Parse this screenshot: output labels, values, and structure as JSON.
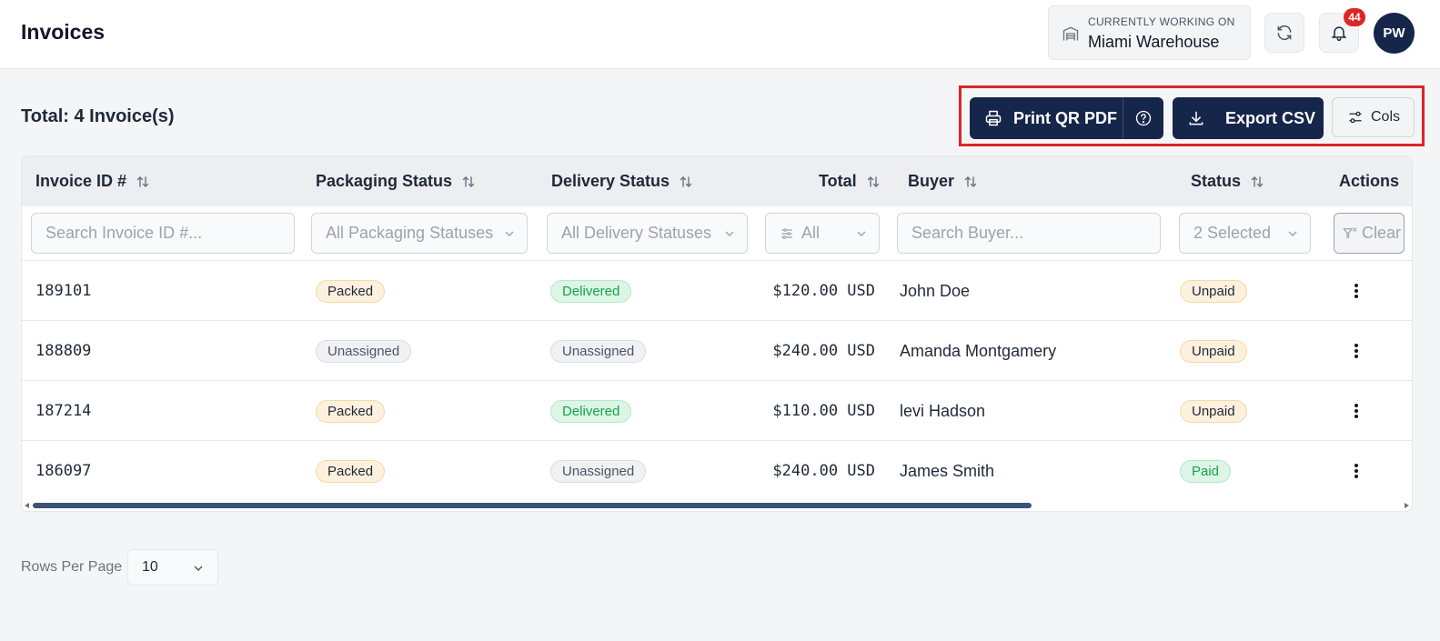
{
  "header": {
    "title": "Invoices",
    "workspace_label": "CURRENTLY WORKING ON",
    "workspace_name": "Miami Warehouse",
    "notification_count": "44",
    "avatar_initials": "PW"
  },
  "toolbar": {
    "total_text": "Total: 4 Invoice(s)",
    "print_label": "Print QR PDF",
    "export_label": "Export CSV",
    "cols_label": "Cols"
  },
  "table": {
    "columns": [
      "Invoice ID #",
      "Packaging Status",
      "Delivery Status",
      "Total",
      "Buyer",
      "Status",
      "Actions"
    ],
    "filters": {
      "invoice_placeholder": "Search Invoice ID #...",
      "packaging": "All Packaging Statuses",
      "delivery": "All Delivery Statuses",
      "total": "All",
      "buyer_placeholder": "Search Buyer...",
      "status": "2 Selected",
      "clear": "Clear"
    },
    "rows": [
      {
        "id": "189101",
        "packaging": "Packed",
        "delivery": "Delivered",
        "total": "$120.00 USD",
        "buyer": "John Doe",
        "status": "Unpaid"
      },
      {
        "id": "188809",
        "packaging": "Unassigned",
        "delivery": "Unassigned",
        "total": "$240.00 USD",
        "buyer": "Amanda Montgamery",
        "status": "Unpaid"
      },
      {
        "id": "187214",
        "packaging": "Packed",
        "delivery": "Delivered",
        "total": "$110.00 USD",
        "buyer": "levi Hadson",
        "status": "Unpaid"
      },
      {
        "id": "186097",
        "packaging": "Packed",
        "delivery": "Unassigned",
        "total": "$240.00 USD",
        "buyer": "James Smith",
        "status": "Paid"
      }
    ]
  },
  "pagination": {
    "rows_per_page_label": "Rows Per Page",
    "rows_per_page_value": "10"
  },
  "colors": {
    "primary": "#16254a",
    "highlight": "#dc2626",
    "badge": "#dc2626"
  },
  "icons": [
    "warehouse-icon",
    "refresh-icon",
    "bell-icon",
    "printer-icon",
    "help-icon",
    "download-icon",
    "sliders-icon",
    "sort-icon",
    "chevron-down-icon",
    "filter-x-icon",
    "kebab-icon"
  ]
}
